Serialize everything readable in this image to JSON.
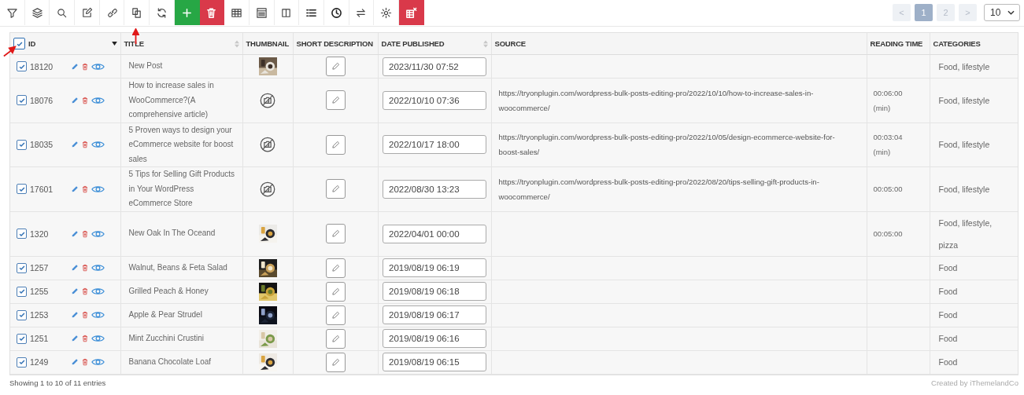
{
  "toolbar": [
    {
      "kind": "filter"
    },
    {
      "kind": "layers"
    },
    {
      "kind": "search"
    },
    {
      "kind": "edit"
    },
    {
      "kind": "link"
    },
    {
      "kind": "duplicate"
    },
    {
      "kind": "refresh"
    },
    {
      "kind": "add"
    },
    {
      "kind": "delete"
    },
    {
      "kind": "table"
    },
    {
      "kind": "sheet"
    },
    {
      "kind": "columns"
    },
    {
      "kind": "list"
    },
    {
      "kind": "clock"
    },
    {
      "kind": "swap"
    },
    {
      "kind": "settings"
    },
    {
      "kind": "reset"
    }
  ],
  "pagination": {
    "prev": "<",
    "pages": [
      {
        "label": "1",
        "selected": true
      },
      {
        "label": "2",
        "selected": false
      }
    ],
    "next": ">",
    "per_page": "10"
  },
  "table": {
    "select_all": {
      "checked": true
    },
    "columns": [
      {
        "label": "ID",
        "sorted_desc": true
      },
      {
        "label": "TITLE",
        "sortable": true
      },
      {
        "label": "THUMBNAIL"
      },
      {
        "label": "SHORT DESCRIPTION"
      },
      {
        "label": "DATE PUBLISHED",
        "sortable": true
      },
      {
        "label": "SOURCE"
      },
      {
        "label": "READING TIME"
      },
      {
        "label": "CATEGORIES"
      }
    ],
    "rows": [
      {
        "checked": true,
        "id": "18120",
        "title": "New Post",
        "has_thumbnail": true,
        "date": "2023/11/30 07:52",
        "categories": "Food, lifestyle"
      },
      {
        "checked": true,
        "id": "18076",
        "title": "How to increase sales in WooCommerce?(A comprehensive article)",
        "has_thumbnail": false,
        "date": "2022/10/10 07:36",
        "source": "https://tryonplugin.com/wordpress-bulk-posts-editing-pro/2022/10/10/how-to-increase-sales-in-woocommerce/",
        "reading_time": "00:06:00 (min)",
        "categories": "Food, lifestyle"
      },
      {
        "checked": true,
        "id": "18035",
        "title": "5 Proven ways to design your eCommerce website for boost sales",
        "has_thumbnail": false,
        "date": "2022/10/17 18:00",
        "source": "https://tryonplugin.com/wordpress-bulk-posts-editing-pro/2022/10/05/design-ecommerce-website-for-boost-sales/",
        "reading_time": "00:03:04 (min)",
        "categories": "Food, lifestyle"
      },
      {
        "checked": true,
        "id": "17601",
        "title": "5 Tips for Selling Gift Products in Your WordPress eCommerce Store",
        "has_thumbnail": false,
        "date": "2022/08/30 13:23",
        "source": "https://tryonplugin.com/wordpress-bulk-posts-editing-pro/2022/08/20/tips-selling-gift-products-in-woocommerce/",
        "reading_time": "00:05:00",
        "categories": "Food, lifestyle"
      },
      {
        "checked": true,
        "id": "1320",
        "title": "New Oak In The Oceand",
        "has_thumbnail": true,
        "date": "2022/04/01 00:00",
        "reading_time": "00:05:00",
        "categories": "Food, lifestyle, pizza"
      },
      {
        "checked": true,
        "id": "1257",
        "title": "Walnut, Beans & Feta Salad",
        "has_thumbnail": true,
        "date": "2019/08/19 06:19",
        "categories": "Food"
      },
      {
        "checked": true,
        "id": "1255",
        "title": "Grilled Peach & Honey",
        "has_thumbnail": true,
        "date": "2019/08/19 06:18",
        "categories": "Food"
      },
      {
        "checked": true,
        "id": "1253",
        "title": "Apple & Pear Strudel",
        "has_thumbnail": true,
        "date": "2019/08/19 06:17",
        "categories": "Food"
      },
      {
        "checked": true,
        "id": "1251",
        "title": "Mint Zucchini Crustini",
        "has_thumbnail": true,
        "date": "2019/08/19 06:16",
        "categories": "Food"
      },
      {
        "checked": true,
        "id": "1249",
        "title": "Banana Chocolate Loaf",
        "has_thumbnail": true,
        "date": "2019/08/19 06:15",
        "categories": "Food"
      }
    ]
  },
  "footer": {
    "entries": "Showing 1 to 10 of 11 entries",
    "credit": "Created by iThemelandCo"
  }
}
